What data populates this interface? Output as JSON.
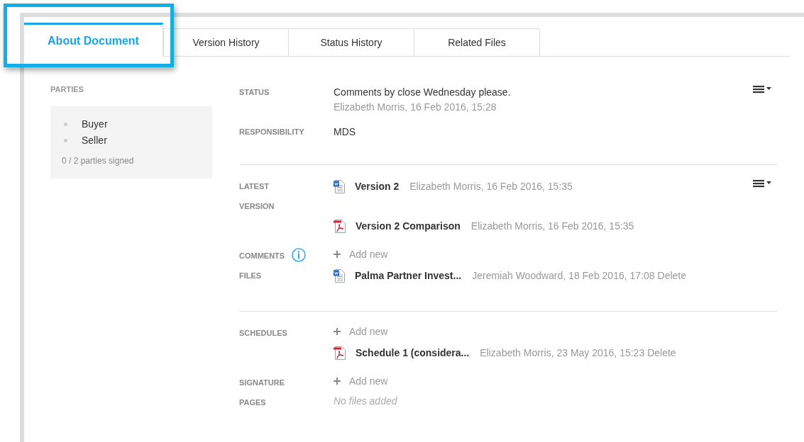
{
  "tabs": [
    {
      "label": "About Document",
      "selected": true,
      "highlighted": true
    },
    {
      "label": "Version History",
      "selected": false,
      "highlighted": false
    },
    {
      "label": "Status History",
      "selected": false,
      "highlighted": false
    },
    {
      "label": "Related Files",
      "selected": false,
      "highlighted": false
    }
  ],
  "parties": {
    "title": "PARTIES",
    "items": [
      "Buyer",
      "Seller"
    ],
    "summary": "0 / 2 parties signed"
  },
  "sections": [
    {
      "rows": [
        {
          "kind": "status",
          "label": [
            "STATUS"
          ],
          "text": "Comments by close Wednesday please.",
          "meta": "Elizabeth Morris, 16 Feb 2016, 15:28",
          "menu": true
        },
        {
          "kind": "text",
          "label": [
            "RESPONSIBILITY"
          ],
          "text": "MDS"
        }
      ]
    },
    {
      "rows": [
        {
          "kind": "files",
          "label": [
            "LATEST",
            "VERSION"
          ],
          "menu": true,
          "files": [
            {
              "kind": "word",
              "name": "Version 2",
              "meta": "Elizabeth Morris, 16 Feb 2016, 15:35"
            },
            {
              "kind": "pdf",
              "name": "Version 2 Comparison",
              "meta": "Elizabeth Morris, 16 Feb 2016, 15:35"
            }
          ]
        },
        {
          "kind": "files",
          "label": [
            "COMMENTS",
            "FILES"
          ],
          "info": true,
          "add": "Add new",
          "files": [
            {
              "kind": "word",
              "name": "Palma Partner Invest...",
              "meta": "Jeremiah Woodward, 18 Feb 2016, 17:08",
              "action": "Delete"
            }
          ]
        }
      ]
    },
    {
      "rows": [
        {
          "kind": "files",
          "label": [
            "SCHEDULES"
          ],
          "add": "Add new",
          "files": [
            {
              "kind": "pdf",
              "name": "Schedule 1 (considera...",
              "meta": "Elizabeth Morris, 23 May 2016, 15:23",
              "action": "Delete"
            }
          ]
        },
        {
          "kind": "files",
          "label": [
            "SIGNATURE",
            "PAGES"
          ],
          "add": "Add new",
          "empty": "No files added"
        }
      ]
    }
  ]
}
